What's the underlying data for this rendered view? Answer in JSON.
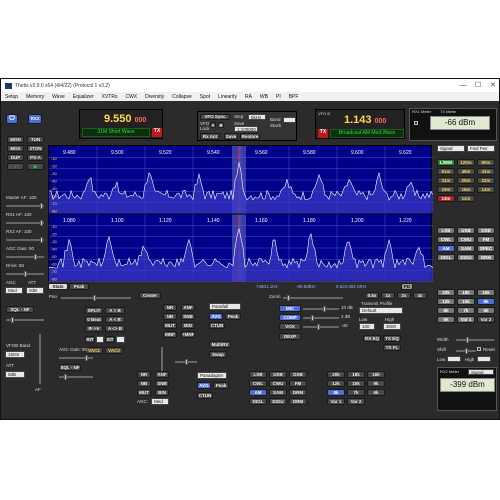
{
  "window": {
    "title": "Thetis v2.9.0 x64 (4/4/22) (Protocol 1 v3.2)",
    "controls": [
      "—",
      "☐",
      "✕"
    ]
  },
  "menu": [
    "Setup",
    "Memory",
    "Wave",
    "Equalizer",
    "XVTRs",
    "CWX",
    "Diversity",
    "Collapse",
    "Spot",
    "Linearity",
    "RA",
    "WB",
    "PI",
    "BPF"
  ],
  "left": {
    "power": "⏻",
    "rx2": "RX2",
    "buttons": [
      "MON",
      "TUN",
      "MOX",
      "2TON",
      "DUP",
      "PS-A"
    ],
    "master_af": "Master AF: 100",
    "rx1_af": "RX1 AF: 100",
    "rx2_af": "RX2 AF: 100",
    "agc_gain": "AGC Gain: 90",
    "drive": "Drive: 50",
    "agc": "AGC",
    "att": "ATT",
    "agc_val": "Med",
    "att_val": "0dB",
    "sql": "SQL - NF",
    "vfob_band": "VFOB Band",
    "vfob_band_val": "160m",
    "att2": "ATT",
    "att2_val": "0dB"
  },
  "vfoA": {
    "freq": "9.550",
    "sub": "000",
    "band": "31M Short Wave",
    "tx": "TX"
  },
  "vfoB": {
    "label": "VFO B",
    "freq": "1.143",
    "sub": "000",
    "band": "Broadcast AM Med Wave",
    "tx": "TX"
  },
  "vfo_sync": {
    "title": "VFO Sync",
    "vfo": "VFO",
    "lock": "Lock",
    "step": "Step:",
    "step_val": "5kHz",
    "save": "Save",
    "restore": "Restore",
    "band": "Band",
    "stack": "Stack",
    "rx_ant": "Rx Ant",
    "a": "A",
    "b": "B",
    "save_val": "1:100000"
  },
  "meters": {
    "rx1": {
      "title": "RX1 Meter",
      "tx": "TX Meter",
      "value": "-66 dBm"
    },
    "rx2": {
      "title": "RX2 Meter",
      "value": "-399 dBm",
      "signal": "Signal"
    }
  },
  "spectrum": {
    "top_ticks": [
      "9.480",
      "9.500",
      "9.520",
      "9.540",
      "9.560",
      "9.580",
      "9.600",
      "9.620"
    ],
    "bottom_ticks": [
      "1.080",
      "1.100",
      "1.120",
      "1.140",
      "1.160",
      "1.180",
      "1.200",
      "1.220"
    ],
    "db_labels": [
      "-10",
      "-20",
      "-30",
      "-40",
      "-50",
      "-60",
      "-70",
      "-80"
    ],
    "status": [
      "74801.1Hz",
      "-80.8dBm",
      "9.624.081 MHz"
    ],
    "display_tabs": [
      "Stats",
      "Peak"
    ],
    "pan": "Pan",
    "center": "Center",
    "zoom": "Zoom",
    "zoom_btns": [
      "0.5x",
      "1x",
      "2x",
      "4x"
    ],
    "fd": "FD"
  },
  "right_modes": {
    "signal": "Signal",
    "fwd_pwr": "Fwd Pwr",
    "bands": [
      "L/MW",
      "120m",
      "90m",
      "61m",
      "49m",
      "41m",
      "31m",
      "25m",
      "22m",
      "19m",
      "16m",
      "14m",
      "13m",
      "11m"
    ],
    "modes": [
      "LSB",
      "USB",
      "DSB",
      "CWL",
      "CWU",
      "FM",
      "AM",
      "SAM",
      "SPEC",
      "DIGL",
      "DIGU",
      "DRM"
    ],
    "filters": [
      "20k",
      "18k",
      "16k",
      "12k",
      "10k",
      "9k",
      "8k",
      "7k",
      "6k",
      "5k",
      "Var 1",
      "Var 2"
    ],
    "width": "Width",
    "shift": "Shift",
    "reset": "Reset",
    "low": "Low",
    "high": "High"
  },
  "center_ctrl": {
    "split": "SPLIT",
    "a_to_b": "A > B",
    "zero_beat": "0 Beat",
    "b_to_a": "A < B",
    "if_v": "IF->V",
    "swap": "A <> B",
    "rit": "RIT",
    "xit": "XIT",
    "vac1": "VAC1",
    "vac2": "VAC2",
    "nr": "NR",
    "anf": "ANF",
    "nb": "NB",
    "snb": "SNB",
    "mut": "MUT",
    "bin": "BIN",
    "mnf": "MNF",
    "mnf_plus": "+MNF",
    "avg": "AVG",
    "peak": "Peak",
    "ctun": "CTUN",
    "display": "Panafall",
    "multirx": "MultiRX",
    "swap_btn": "Swap",
    "mic": "MIC",
    "comp": "COMP",
    "vox": "VOX",
    "dexp": "DEXP",
    "mic_val": "10 dB",
    "comp_val": "2 dB",
    "vox_val": "-40",
    "tx_profile": "Transmit Profile",
    "tx_profile_val": "Default",
    "low": "Low",
    "high": "High",
    "low_val": "100",
    "high_val": "3000",
    "rx_eq": "RX EQ",
    "tx_eq": "TX EQ",
    "tx_fl": "TX FL",
    "agc_gain2": "AGC Gain: 90",
    "sql2": "SQL - NF",
    "agc2": "AGC:",
    "agc2_val": "Med",
    "ctun2": "CTUN",
    "avg2": "AVG",
    "peak2": "Peak",
    "display2": "Panadapter"
  },
  "bottom_modes": [
    "LSB",
    "USB",
    "DSB",
    "CWL",
    "CWU",
    "FM",
    "AM",
    "SAM",
    "DRM",
    "DIGL",
    "DIGU",
    "DRM"
  ],
  "bottom_filters": [
    "20k",
    "18k",
    "16k",
    "12k",
    "10k",
    "9k",
    "8k",
    "7k",
    "6k",
    "Var 1",
    "Var 2"
  ]
}
